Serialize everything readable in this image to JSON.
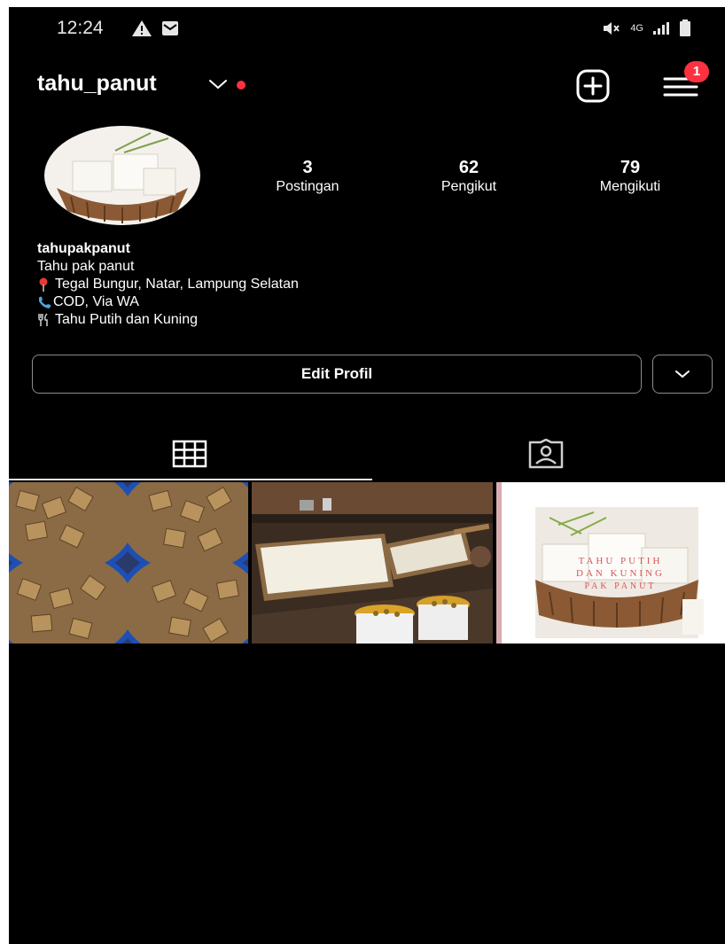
{
  "status_bar": {
    "time": "12:24",
    "left_icons": [
      "warning-icon",
      "mail-icon"
    ],
    "right_icons": [
      "mute-icon",
      "network-4g-icon",
      "signal-icon",
      "battery-icon"
    ],
    "network_label": "4G"
  },
  "header": {
    "username": "tahu_panut",
    "notification_badge": "1",
    "icons": [
      "chevron-down-icon",
      "add-post-icon",
      "menu-icon"
    ]
  },
  "profile": {
    "stats": [
      {
        "value": "3",
        "label": "Postingan"
      },
      {
        "value": "62",
        "label": "Pengikut"
      },
      {
        "value": "79",
        "label": "Mengikuti"
      }
    ],
    "bio": {
      "name": "tahupakpanut",
      "tagline": "Tahu pak panut",
      "location": "Tegal Bungur, Natar, Lampung Selatan",
      "contact": "COD, Via WA",
      "product": "Tahu Putih dan Kuning"
    }
  },
  "actions": {
    "edit_profile_label": "Edit Profil"
  },
  "tabs": [
    {
      "name": "posts-grid",
      "icon": "grid-icon",
      "selected": true
    },
    {
      "name": "tagged",
      "icon": "tagged-person-icon",
      "selected": false
    }
  ],
  "posts": {
    "overlay_text": [
      "TAHU PUTIH",
      "DAN KUNING",
      "PAK PANUT"
    ]
  },
  "colors": {
    "background": "#000000",
    "text": "#ffffff",
    "secondary_border": "#8c8c8c",
    "live_dot": "#ff3040",
    "badge": "#ff3040",
    "location_pin": "#e53935",
    "phone": "#4fa3d9"
  }
}
